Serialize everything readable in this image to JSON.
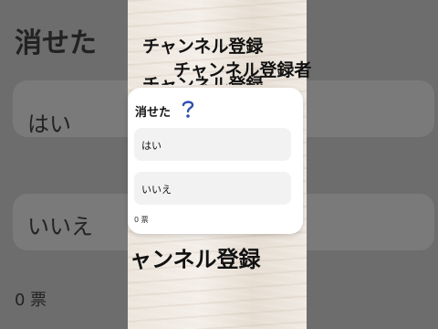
{
  "poll": {
    "title": "消せた",
    "options": [
      {
        "label": "はい"
      },
      {
        "label": "いいえ"
      }
    ],
    "vote_count": "0 票",
    "icon": "question-mark-icon"
  },
  "overlay": {
    "line1": "チャンネル登録",
    "line2": "チャンネル登録者",
    "line3": "チャンネル登録",
    "line4": "ャンネル登録"
  },
  "colors": {
    "card_bg": "#ffffff",
    "option_bg": "#f2f2f2",
    "side_dim": "#6d6d6d",
    "icon_blue": "#2f4fb3"
  }
}
